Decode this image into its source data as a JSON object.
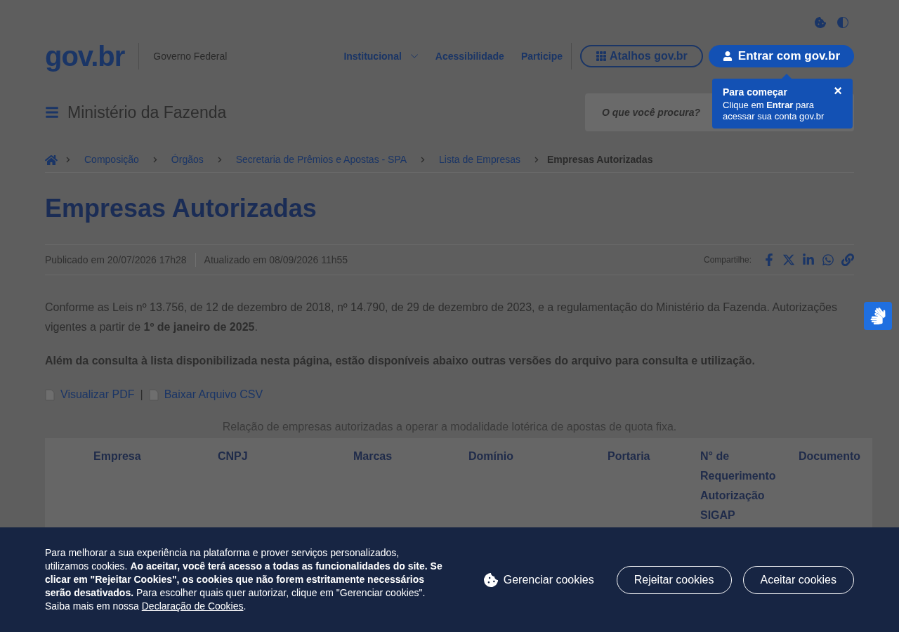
{
  "header": {
    "logo": "gov.br",
    "org": "Governo Federal",
    "nav": [
      {
        "label": "Institucional",
        "kind": "dropdown"
      },
      {
        "label": "Acessibilidade",
        "kind": "link"
      },
      {
        "label": "Participe",
        "kind": "link"
      }
    ],
    "shortcuts": "Atalhos gov.br",
    "login": "Entrar com gov.br"
  },
  "tooltip": {
    "title": "Para começar",
    "text": "Clique em **Entrar** para acessar sua conta gov.br",
    "close": "×"
  },
  "site": {
    "title": "Ministério da Fazenda",
    "search": {
      "placeholder": "O que você procura?"
    }
  },
  "breadcrumb": [
    "Composição",
    "Órgãos",
    "Secretaria de Prêmios e Apostas - SPA",
    "Lista de Empresas",
    "Empresas Autorizadas"
  ],
  "page": {
    "title": "Empresas Autorizadas",
    "published": "Publicado em 20/07/2026 17h28",
    "updated": "Atualizado em 08/09/2026 11h55",
    "share_label": "Compartilhe:",
    "paragraphs": [
      "Conforme as Leis nº 13.756, de 12 de dezembro de 2018, nº 14.790, de 29 de dezembro de 2023, e a regulamentação do Ministério da Fazenda. Autorizações vigentes a partir de **1º de janeiro de 2025**.",
      "**Além da consulta à lista disponibilizada nesta página, estão disponíveis abaixo outras versões do arquivo para consulta e utilização.**"
    ],
    "links": [
      "Visualizar PDF",
      "Baixar Arquivo CSV"
    ],
    "link_separator": "|"
  },
  "table": {
    "caption": "Relação de empresas autorizadas a operar a modalidade lotérica de apostas de quota fixa.",
    "columns": [
      "Empresa",
      "CNPJ",
      "Marcas",
      "Domínio",
      "Portaria",
      "N° de Requerimento Autorização SIGAP",
      "Documento"
    ]
  },
  "cookie_banner": {
    "text": "Para melhorar a sua experiência na plataforma e prover serviços personalizados, utilizamos cookies. **Ao aceitar, você terá acesso a todas as funcionalidades do site. Se clicar em \"Rejeitar Cookies\", os cookies que não forem estritamente necessários serão desativados.** Para escolher quais quer autorizar, clique em \"Gerenciar cookies\". Saiba mais em nossa",
    "link": "Declaração de Cookies",
    "end": ".",
    "manage": "Gerenciar cookies",
    "reject": "Rejeitar cookies",
    "accept": "Aceitar cookies"
  }
}
